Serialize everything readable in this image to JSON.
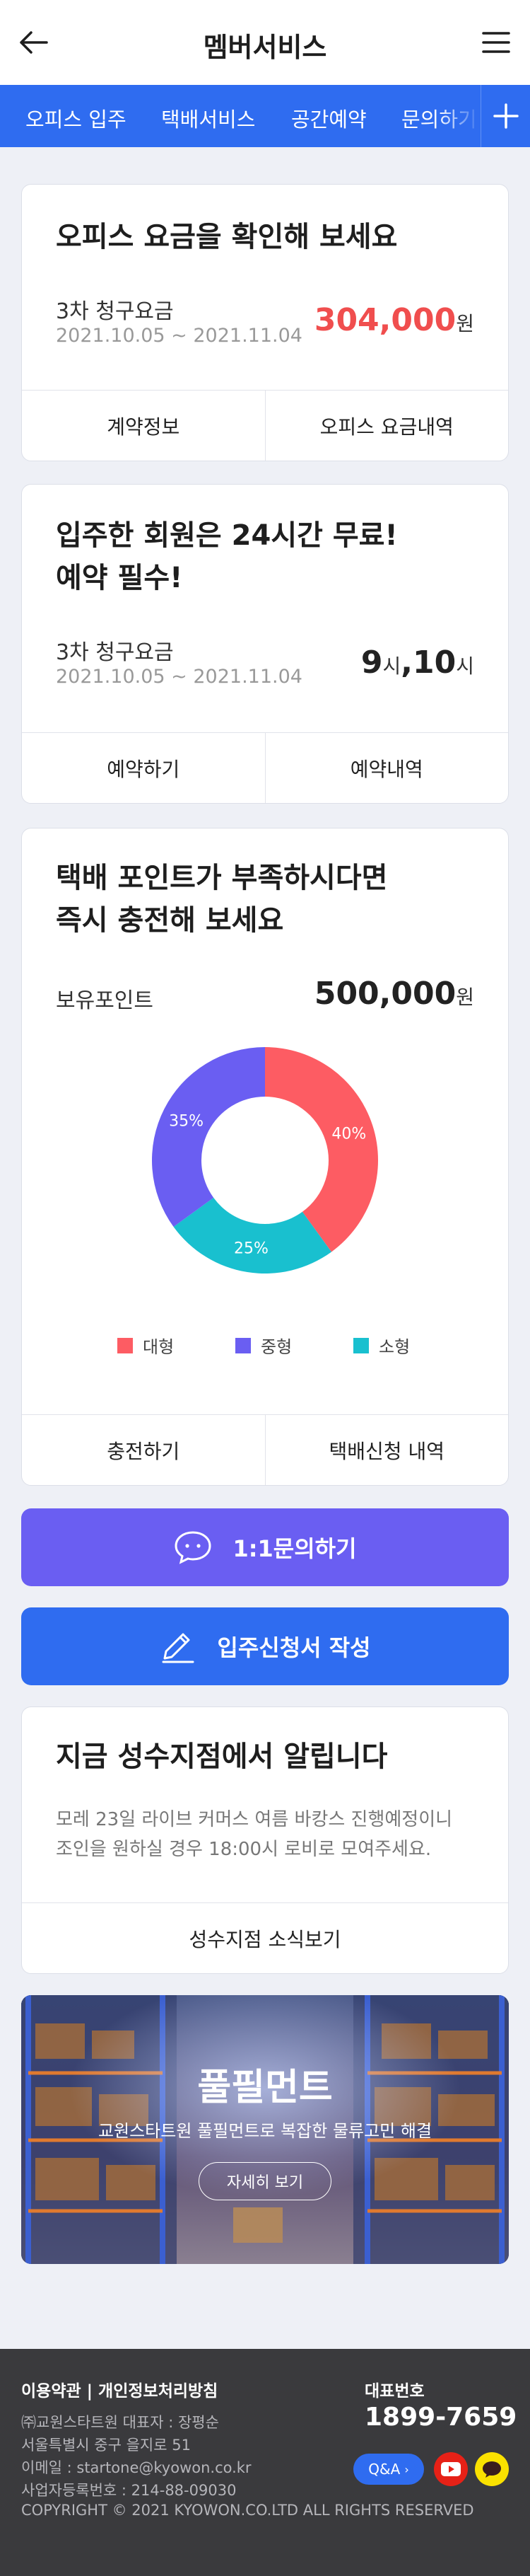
{
  "header": {
    "title": "멤버서비스",
    "back_icon": "arrow-left-icon",
    "menu_icon": "hamburger-menu-icon"
  },
  "tabs": {
    "items": [
      {
        "label": "오피스 입주"
      },
      {
        "label": "택배서비스"
      },
      {
        "label": "공간예약"
      },
      {
        "label": "문의하기"
      }
    ],
    "add_icon": "plus-icon"
  },
  "office_card": {
    "title": "오피스 요금을 확인해 보세요",
    "bill_label": "3차 청구요금",
    "period": "2021.10.05 ~ 2021.11.04",
    "amount": "304,000",
    "unit": "원",
    "amount_color": "#f04e4e",
    "buttons": [
      "계약정보",
      "오피스 요금내역"
    ]
  },
  "meeting_card": {
    "title_line1": "입주한 회원은 24시간 무료!",
    "title_line2": "예약 필수!",
    "bill_label": "3차 청구요금",
    "period": "2021.10.05 ~ 2021.11.04",
    "hours_value": "9",
    "hours_unit": "시",
    "separator": ",",
    "count_value": "10",
    "count_unit": "시",
    "buttons": [
      "예약하기",
      "예약내역"
    ]
  },
  "parcel_card": {
    "title_line1": "택배 포인트가 부족하시다면",
    "title_line2": "즉시 충전해 보세요",
    "points_label": "보유포인트",
    "points_value": "500,000",
    "unit": "원",
    "buttons": [
      "충전하기",
      "택배신청 내역"
    ]
  },
  "chart_data": {
    "type": "pie",
    "donut": true,
    "series": [
      {
        "name": "대형",
        "value": 40,
        "label": "40%",
        "color": "#fd5c63"
      },
      {
        "name": "소형",
        "value": 25,
        "label": "25%",
        "color": "#19c0cf"
      },
      {
        "name": "중형",
        "value": 35,
        "label": "35%",
        "color": "#6a5ef2"
      }
    ],
    "legend_order": [
      "대형",
      "중형",
      "소형"
    ],
    "legend_position": "bottom"
  },
  "inquiry_button": {
    "label": "1:1문의하기",
    "icon": "chat-bubble-icon",
    "color": "#6a5ef2"
  },
  "apply_button": {
    "label": "입주신청서 작성",
    "icon": "pencil-icon",
    "color": "#2f6cf0"
  },
  "notice_card": {
    "title": "지금 성수지점에서 알립니다",
    "body_line1": "모레 23일 라이브 커머스 여름 바캉스 진행예정이니",
    "body_line2": "조인을 원하실 경우 18:00시 로비로 모여주세요.",
    "button": "성수지점 소식보기"
  },
  "banner": {
    "title": "풀필먼트",
    "subtitle": "교원스타트원 풀필먼트로 복잡한 물류고민 해결",
    "button": "자세히 보기"
  },
  "footer": {
    "links": "이용약관 | 개인정보처리방침",
    "company": "㈜교원스타트원 대표자 : 장평순",
    "address": "서울특별시 중구 을지로 51",
    "email": "이메일 : startone@kyowon.co.kr",
    "biz_no": "사업자등록번호 : 214-88-09030",
    "copyright": "COPYRIGHT © 2021 KYOWON.CO.LTD ALL RIGHTS RESERVED",
    "rep_label": "대표번호",
    "rep_number": "1899-7659",
    "qa_button": "Q&A",
    "youtube_icon": "youtube-icon",
    "kakao_icon": "kakaotalk-icon"
  }
}
